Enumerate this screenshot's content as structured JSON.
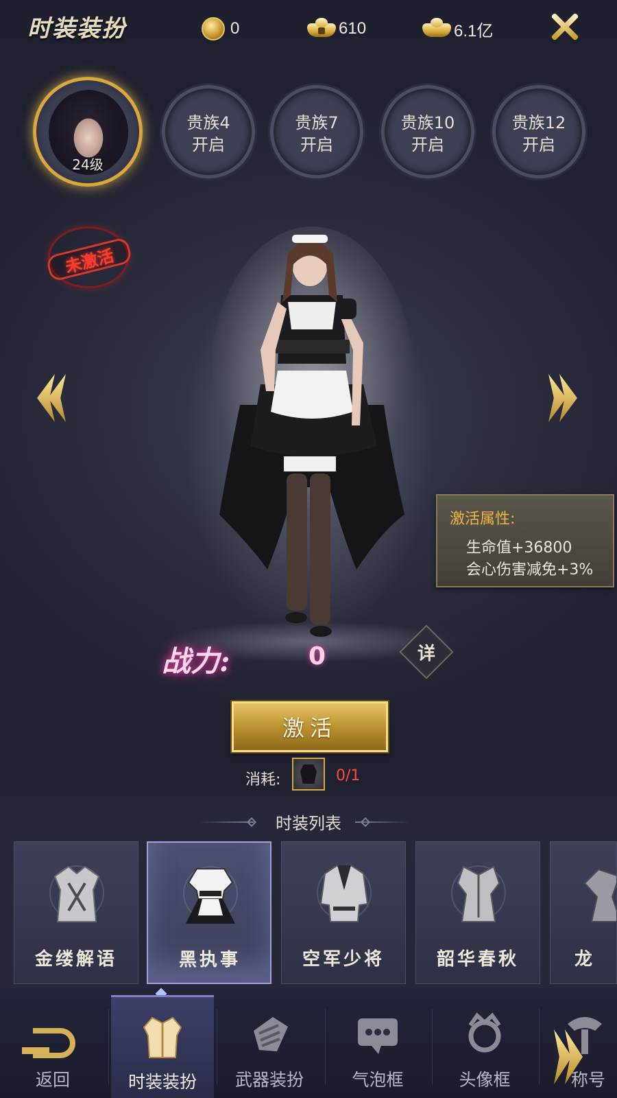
{
  "header": {
    "title": "时装装扮",
    "currencies": [
      {
        "icon": "gold-medal-icon",
        "value": "0"
      },
      {
        "icon": "locked-ingot-icon",
        "value": "610"
      },
      {
        "icon": "gold-ingot-icon",
        "value": "6.1亿"
      }
    ]
  },
  "avatar": {
    "level": "24级"
  },
  "noble_slots": [
    {
      "line1": "贵族4",
      "line2": "开启"
    },
    {
      "line1": "贵族7",
      "line2": "开启"
    },
    {
      "line1": "贵族10",
      "line2": "开启"
    },
    {
      "line1": "贵族12",
      "line2": "开启"
    }
  ],
  "status_stamp": "未激活",
  "attributes": {
    "title": "激活属性:",
    "lines": [
      "生命值+36800",
      "会心伤害减免+3%"
    ]
  },
  "power": {
    "label": "战力:",
    "value": "0",
    "detail_label": "详"
  },
  "activate": {
    "button_label": "激活",
    "cost_label": "消耗:",
    "cost_value": "0/1",
    "cost_color": "#ff4b3d"
  },
  "costume_list": {
    "title": "时装列表",
    "items": [
      {
        "name": "金缕解语",
        "selected": false
      },
      {
        "name": "黑执事",
        "selected": true
      },
      {
        "name": "空军少将",
        "selected": false
      },
      {
        "name": "韶华春秋",
        "selected": false
      },
      {
        "name": "龙",
        "selected": false
      }
    ]
  },
  "nav": {
    "items": [
      {
        "label": "返回",
        "icon": "back-icon"
      },
      {
        "label": "时装装扮",
        "icon": "outfit-icon",
        "active": true
      },
      {
        "label": "武器装扮",
        "icon": "weapon-icon"
      },
      {
        "label": "气泡框",
        "icon": "chat-bubble-icon"
      },
      {
        "label": "头像框",
        "icon": "avatar-frame-icon"
      },
      {
        "label": "称号",
        "icon": "title-icon"
      }
    ]
  },
  "colors": {
    "gold": "#d8a83c",
    "accent": "#9ea4d8",
    "background": "#262839"
  }
}
